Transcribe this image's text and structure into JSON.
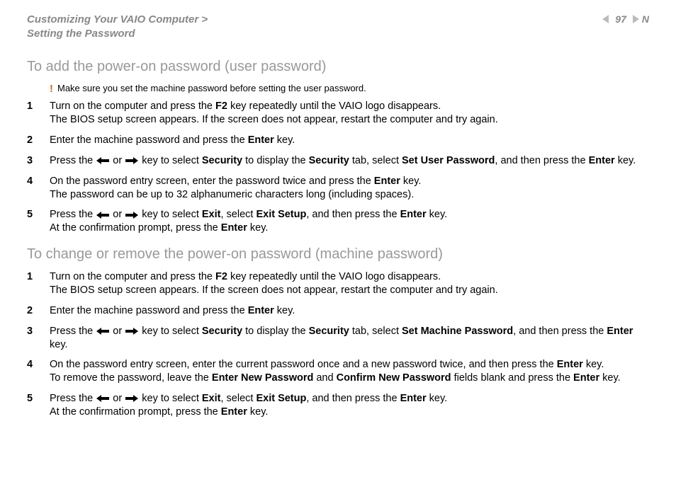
{
  "header": {
    "breadcrumb_line1": "Customizing Your VAIO Computer >",
    "breadcrumb_line2": "Setting the Password",
    "page_number": "97",
    "nav_letter": "N"
  },
  "section1": {
    "title": "To add the power-on password (user password)",
    "warning": "Make sure you set the machine password before setting the user password.",
    "steps": [
      {
        "parts": [
          {
            "t": "Turn on the computer and press the "
          },
          {
            "t": "F2",
            "b": true
          },
          {
            "t": " key repeatedly until the VAIO logo disappears."
          }
        ],
        "line2": [
          {
            "t": "The BIOS setup screen appears. If the screen does not appear, restart the computer and try again."
          }
        ]
      },
      {
        "parts": [
          {
            "t": "Enter the machine password and press the "
          },
          {
            "t": "Enter",
            "b": true
          },
          {
            "t": " key."
          }
        ]
      },
      {
        "parts": [
          {
            "t": "Press the "
          },
          {
            "arrow": "left"
          },
          {
            "t": " or "
          },
          {
            "arrow": "right"
          },
          {
            "t": " key to select "
          },
          {
            "t": "Security",
            "b": true
          },
          {
            "t": " to display the "
          },
          {
            "t": "Security",
            "b": true
          },
          {
            "t": " tab, select "
          },
          {
            "t": "Set User Password",
            "b": true
          },
          {
            "t": ", and then press the "
          },
          {
            "t": "Enter",
            "b": true
          },
          {
            "t": " key."
          }
        ]
      },
      {
        "parts": [
          {
            "t": "On the password entry screen, enter the password twice and press the "
          },
          {
            "t": "Enter",
            "b": true
          },
          {
            "t": " key."
          }
        ],
        "line2": [
          {
            "t": "The password can be up to 32 alphanumeric characters long (including spaces)."
          }
        ]
      },
      {
        "parts": [
          {
            "t": "Press the "
          },
          {
            "arrow": "left"
          },
          {
            "t": " or "
          },
          {
            "arrow": "right"
          },
          {
            "t": " key to select "
          },
          {
            "t": "Exit",
            "b": true
          },
          {
            "t": ", select "
          },
          {
            "t": "Exit Setup",
            "b": true
          },
          {
            "t": ", and then press the "
          },
          {
            "t": "Enter",
            "b": true
          },
          {
            "t": " key."
          }
        ],
        "line2": [
          {
            "t": "At the confirmation prompt, press the "
          },
          {
            "t": "Enter",
            "b": true
          },
          {
            "t": " key."
          }
        ]
      }
    ]
  },
  "section2": {
    "title": "To change or remove the power-on password (machine password)",
    "steps": [
      {
        "parts": [
          {
            "t": "Turn on the computer and press the "
          },
          {
            "t": "F2",
            "b": true
          },
          {
            "t": " key repeatedly until the VAIO logo disappears."
          }
        ],
        "line2": [
          {
            "t": "The BIOS setup screen appears. If the screen does not appear, restart the computer and try again."
          }
        ]
      },
      {
        "parts": [
          {
            "t": "Enter the machine password and press the "
          },
          {
            "t": "Enter",
            "b": true
          },
          {
            "t": " key."
          }
        ]
      },
      {
        "parts": [
          {
            "t": "Press the "
          },
          {
            "arrow": "left"
          },
          {
            "t": " or "
          },
          {
            "arrow": "right"
          },
          {
            "t": " key to select "
          },
          {
            "t": "Security",
            "b": true
          },
          {
            "t": " to display the "
          },
          {
            "t": "Security",
            "b": true
          },
          {
            "t": " tab, select "
          },
          {
            "t": "Set Machine Password",
            "b": true
          },
          {
            "t": ", and then press the "
          },
          {
            "t": "Enter",
            "b": true
          },
          {
            "t": " key."
          }
        ]
      },
      {
        "parts": [
          {
            "t": "On the password entry screen, enter the current password once and a new password twice, and then press the "
          },
          {
            "t": "Enter",
            "b": true
          },
          {
            "t": " key."
          }
        ],
        "line2": [
          {
            "t": "To remove the password, leave the "
          },
          {
            "t": "Enter New Password",
            "b": true
          },
          {
            "t": " and "
          },
          {
            "t": "Confirm New Password",
            "b": true
          },
          {
            "t": " fields blank and press the "
          },
          {
            "t": "Enter",
            "b": true
          },
          {
            "t": " key."
          }
        ]
      },
      {
        "parts": [
          {
            "t": "Press the "
          },
          {
            "arrow": "left"
          },
          {
            "t": " or "
          },
          {
            "arrow": "right"
          },
          {
            "t": " key to select "
          },
          {
            "t": "Exit",
            "b": true
          },
          {
            "t": ", select "
          },
          {
            "t": "Exit Setup",
            "b": true
          },
          {
            "t": ", and then press the "
          },
          {
            "t": "Enter",
            "b": true
          },
          {
            "t": " key."
          }
        ],
        "line2": [
          {
            "t": "At the confirmation prompt, press the "
          },
          {
            "t": "Enter",
            "b": true
          },
          {
            "t": " key."
          }
        ]
      }
    ]
  }
}
